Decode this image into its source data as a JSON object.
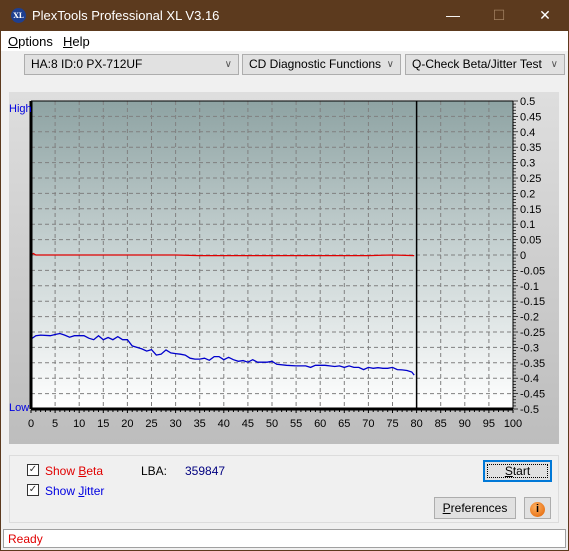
{
  "window": {
    "title": "PlexTools Professional XL V3.16",
    "icon_label": "XL",
    "minimize": "—",
    "maximize": "☐",
    "close": "✕"
  },
  "menu": {
    "items": [
      {
        "label": "Options",
        "accel": "O",
        "rest": "ptions"
      },
      {
        "label": "Help",
        "accel": "H",
        "rest": "elp"
      }
    ]
  },
  "toolbar": {
    "drive": "HA:8 ID:0  PX-712UF",
    "function": "CD Diagnostic Functions",
    "test": "Q-Check Beta/Jitter Test",
    "arrow": "∨"
  },
  "chart_data": {
    "type": "line",
    "title": "",
    "xlabel": "",
    "ylabel": "",
    "left_axis_labels": {
      "high": "High",
      "low": "Low"
    },
    "xlim": [
      0,
      100
    ],
    "ylim": [
      -0.5,
      0.5
    ],
    "x_ticks": [
      0,
      5,
      10,
      15,
      20,
      25,
      30,
      35,
      40,
      45,
      50,
      55,
      60,
      65,
      70,
      75,
      80,
      85,
      90,
      95,
      100
    ],
    "y_ticks": [
      0.5,
      0.45,
      0.4,
      0.35,
      0.3,
      0.25,
      0.2,
      0.15,
      0.1,
      0.05,
      0,
      -0.05,
      -0.1,
      -0.15,
      -0.2,
      -0.25,
      -0.3,
      -0.35,
      -0.4,
      -0.45,
      -0.5
    ],
    "grid": true,
    "end_marker_x": 80,
    "series": [
      {
        "name": "Beta",
        "color": "#e00000",
        "x": [
          0,
          0.5,
          1,
          5,
          10,
          15,
          20,
          25,
          30,
          35,
          40,
          45,
          50,
          55,
          60,
          65,
          70,
          75,
          79.5
        ],
        "y": [
          0.0,
          0.005,
          0.0,
          0.0,
          0.0,
          0.0,
          0.0,
          0.0,
          0.0,
          -0.002,
          -0.002,
          -0.002,
          -0.002,
          -0.002,
          -0.002,
          -0.002,
          -0.002,
          0.0,
          -0.002
        ]
      },
      {
        "name": "Jitter",
        "color": "#0000cc",
        "x": [
          0,
          1,
          2,
          4,
          5,
          6,
          7,
          8,
          9,
          10,
          11,
          12,
          13,
          14,
          15,
          16,
          17,
          18,
          19,
          20,
          21,
          22,
          23,
          24,
          25,
          26,
          27,
          28,
          29,
          30,
          31,
          32,
          33,
          34,
          35,
          36,
          37,
          38,
          39,
          40,
          41,
          42,
          43,
          44,
          45,
          46,
          47,
          48,
          49,
          50,
          51,
          53,
          55,
          57,
          58,
          59,
          60,
          61,
          62,
          63,
          64,
          65,
          66,
          67,
          68,
          69,
          70,
          71,
          72,
          73,
          74,
          75,
          76,
          77,
          78,
          79,
          79.5
        ],
        "y": [
          -0.273,
          -0.262,
          -0.26,
          -0.262,
          -0.258,
          -0.255,
          -0.26,
          -0.267,
          -0.262,
          -0.262,
          -0.262,
          -0.27,
          -0.275,
          -0.262,
          -0.275,
          -0.268,
          -0.275,
          -0.265,
          -0.275,
          -0.275,
          -0.295,
          -0.3,
          -0.305,
          -0.312,
          -0.307,
          -0.325,
          -0.322,
          -0.308,
          -0.318,
          -0.32,
          -0.322,
          -0.325,
          -0.335,
          -0.338,
          -0.338,
          -0.335,
          -0.342,
          -0.33,
          -0.33,
          -0.34,
          -0.332,
          -0.34,
          -0.345,
          -0.343,
          -0.348,
          -0.34,
          -0.348,
          -0.348,
          -0.348,
          -0.345,
          -0.355,
          -0.358,
          -0.36,
          -0.36,
          -0.365,
          -0.358,
          -0.358,
          -0.358,
          -0.36,
          -0.362,
          -0.36,
          -0.365,
          -0.36,
          -0.365,
          -0.365,
          -0.372,
          -0.365,
          -0.368,
          -0.366,
          -0.368,
          -0.368,
          -0.365,
          -0.372,
          -0.373,
          -0.375,
          -0.38,
          -0.39
        ]
      }
    ]
  },
  "controls": {
    "show_beta": {
      "label": "Show Beta",
      "pre": "Show ",
      "accel": "B",
      "rest": "eta",
      "checked": true,
      "color": "#e00000"
    },
    "show_jitter": {
      "label": "Show Jitter",
      "pre": "Show ",
      "accel": "J",
      "rest": "itter",
      "checked": true,
      "color": "#0000e0"
    },
    "lba_label": "LBA:",
    "lba_value": "359847",
    "start_button": {
      "label": "Start",
      "accel": "S",
      "rest": "tart"
    },
    "preferences_button": {
      "label": "Preferences",
      "accel": "P",
      "rest": "references"
    },
    "info_button": "i"
  },
  "status": {
    "text": "Ready",
    "color": "#e00000"
  }
}
